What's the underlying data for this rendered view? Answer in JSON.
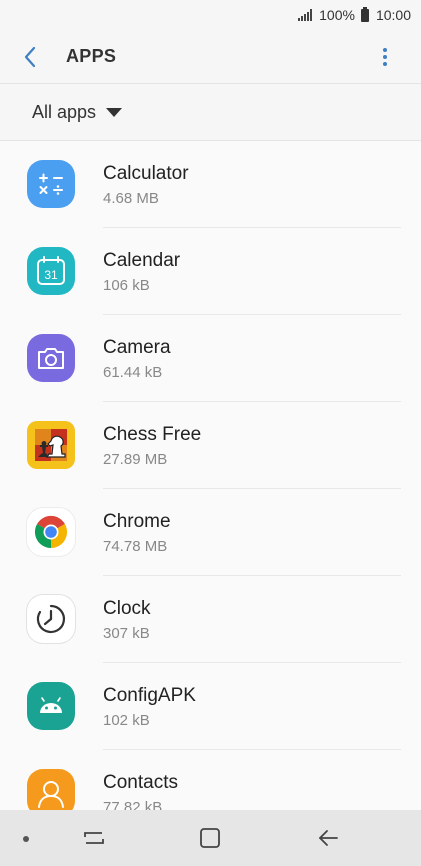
{
  "status_bar": {
    "battery": "100%",
    "time": "10:00"
  },
  "header": {
    "title": "APPS"
  },
  "filter": {
    "label": "All apps"
  },
  "apps": [
    {
      "name": "Calculator",
      "size": "4.68 MB",
      "icon": "calculator-icon"
    },
    {
      "name": "Calendar",
      "size": "106 kB",
      "icon": "calendar-icon",
      "calendar_day": "31"
    },
    {
      "name": "Camera",
      "size": "61.44 kB",
      "icon": "camera-icon"
    },
    {
      "name": "Chess Free",
      "size": "27.89 MB",
      "icon": "chess-icon"
    },
    {
      "name": "Chrome",
      "size": "74.78 MB",
      "icon": "chrome-icon"
    },
    {
      "name": "Clock",
      "size": "307 kB",
      "icon": "clock-icon"
    },
    {
      "name": "ConfigAPK",
      "size": "102 kB",
      "icon": "android-icon"
    },
    {
      "name": "Contacts",
      "size": "77.82 kB",
      "icon": "contacts-icon"
    }
  ],
  "colors": {
    "accent": "#3e7fc4",
    "calculator": "#4a9ff0",
    "calendar": "#21b8c4",
    "camera": "#7a6ae0",
    "configapk": "#1aa393",
    "contacts": "#f59a1c"
  }
}
